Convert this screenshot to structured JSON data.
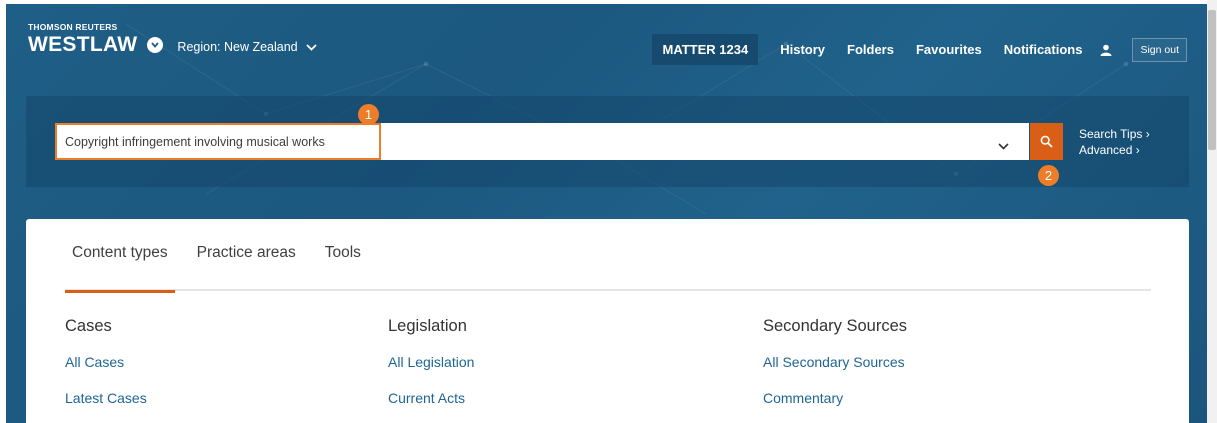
{
  "brand": {
    "company": "THOMSON REUTERS",
    "product": "WESTLAW",
    "region_label": "Region: New Zealand"
  },
  "nav": {
    "matter": "MATTER 1234",
    "items": [
      "History",
      "Folders",
      "Favourites",
      "Notifications"
    ],
    "sign_out": "Sign out"
  },
  "search": {
    "query": "Copyright infringement involving musical works",
    "tips": "Search Tips",
    "advanced": "Advanced",
    "annotations": [
      "1",
      "2"
    ]
  },
  "tabs": [
    {
      "label": "Content types",
      "active": true
    },
    {
      "label": "Practice areas",
      "active": false
    },
    {
      "label": "Tools",
      "active": false
    }
  ],
  "columns": [
    {
      "heading": "Cases",
      "links": [
        "All Cases",
        "Latest Cases"
      ]
    },
    {
      "heading": "Legislation",
      "links": [
        "All Legislation",
        "Current Acts"
      ]
    },
    {
      "heading": "Secondary Sources",
      "links": [
        "All Secondary Sources",
        "Commentary"
      ]
    }
  ],
  "icons": {
    "caret": "chevron-down-icon",
    "user": "user-icon",
    "search": "search-icon"
  },
  "colors": {
    "accent": "#ee7d2a",
    "search_button": "#d95e16",
    "header_bg": "#1f5e86",
    "link": "#1e6595"
  }
}
